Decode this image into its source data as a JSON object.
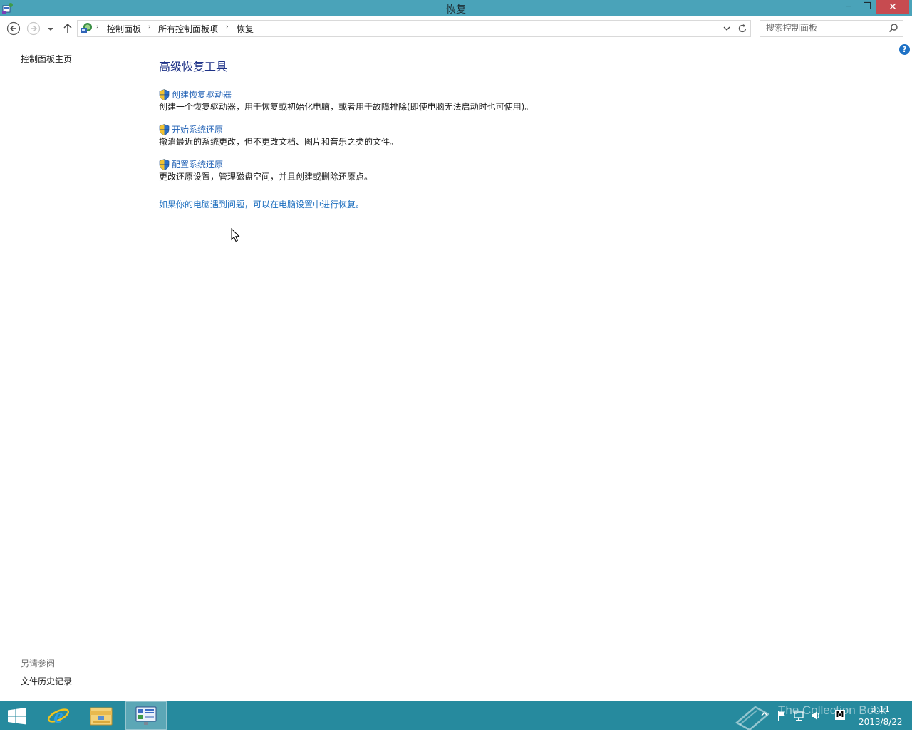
{
  "window": {
    "title": "恢复",
    "minimize_glyph": "─",
    "restore_glyph": "❐",
    "close_glyph": "✕"
  },
  "breadcrumb": {
    "items": [
      "控制面板",
      "所有控制面板项",
      "恢复"
    ],
    "separator": "›"
  },
  "search": {
    "placeholder": "搜索控制面板",
    "value": ""
  },
  "sidebar": {
    "home_link": "控制面板主页",
    "see_also_title": "另请参阅",
    "see_also_link": "文件历史记录"
  },
  "help_glyph": "?",
  "main": {
    "heading": "高级恢复工具",
    "tools": [
      {
        "label": "创建恢复驱动器",
        "description": "创建一个恢复驱动器，用于恢复或初始化电脑，或者用于故障排除(即使电脑无法启动时也可使用)。",
        "icon": "uac-shield-icon"
      },
      {
        "label": "开始系统还原",
        "description": "撤消最近的系统更改，但不更改文档、图片和音乐之类的文件。",
        "icon": "uac-shield-icon"
      },
      {
        "label": "配置系统还原",
        "description": "更改还原设置，管理磁盘空间，并且创建或删除还原点。",
        "icon": "uac-shield-icon"
      }
    ],
    "pc_settings_link": "如果你的电脑遇到问题，可以在电脑设置中进行恢复。"
  },
  "taskbar": {
    "pinned": [
      "internet-explorer-icon",
      "file-explorer-icon",
      "control-panel-icon"
    ],
    "active": "control-panel-icon",
    "clock_time": "3:11",
    "clock_date": "2013/8/22",
    "watermark": "The Collection Book",
    "ime_label": "M"
  },
  "colors": {
    "titlebar": "#4aa3b9",
    "taskbar": "#268a9e",
    "close_button": "#c74b50",
    "heading": "#1e3287",
    "link": "#1e5fb4"
  }
}
